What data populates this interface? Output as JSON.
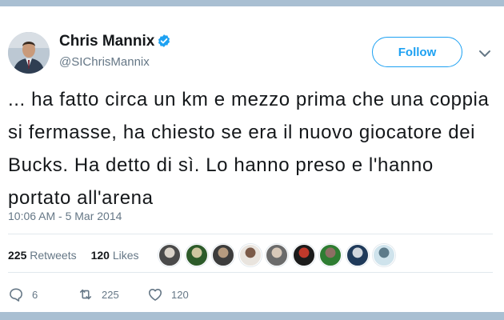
{
  "tweet": {
    "author": {
      "name": "Chris Mannix",
      "handle": "@SIChrisMannix",
      "verified": true
    },
    "follow_label": "Follow",
    "text": "... ha fatto circa un km e mezzo prima che una coppia si fermasse, ha chiesto se era il nuovo giocatore dei Bucks. Ha detto di sì. Lo hanno preso e l'hanno portato all'arena",
    "timestamp": "10:06 AM - 5 Mar 2014",
    "stats": {
      "retweets_count": "225",
      "retweets_label": "Retweets",
      "likes_count": "120",
      "likes_label": "Likes"
    },
    "retweeter_avatar_count": 9,
    "actions": {
      "reply_count": "6",
      "retweet_count": "225",
      "like_count": "120"
    }
  },
  "colors": {
    "accent": "#1da1f2",
    "text_primary": "#14171a",
    "text_secondary": "#657786",
    "divider": "#e1e8ed",
    "frame": "#a9bfd2"
  },
  "icons": {
    "verified": "verified-badge-icon",
    "menu": "chevron-down-icon",
    "reply": "reply-icon",
    "retweet": "retweet-icon",
    "like": "heart-icon"
  }
}
